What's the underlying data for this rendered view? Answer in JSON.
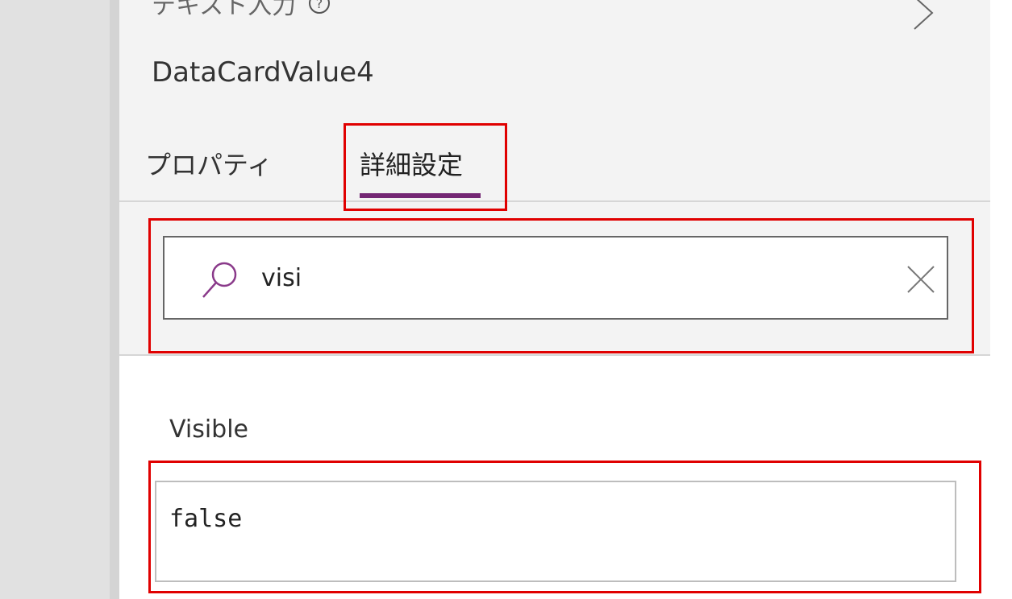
{
  "panel": {
    "control_type": "テキスト入力",
    "control_name": "DataCardValue4"
  },
  "tabs": [
    {
      "label": "プロパティ",
      "active": false
    },
    {
      "label": "詳細設定",
      "active": true
    }
  ],
  "search": {
    "value": "visi",
    "icon": "search-icon",
    "clear_icon": "close-icon"
  },
  "property": {
    "label": "Visible",
    "formula": "false"
  },
  "colors": {
    "accent": "#742774",
    "highlight": "#e00000",
    "panel_bg": "#f3f3f3"
  }
}
